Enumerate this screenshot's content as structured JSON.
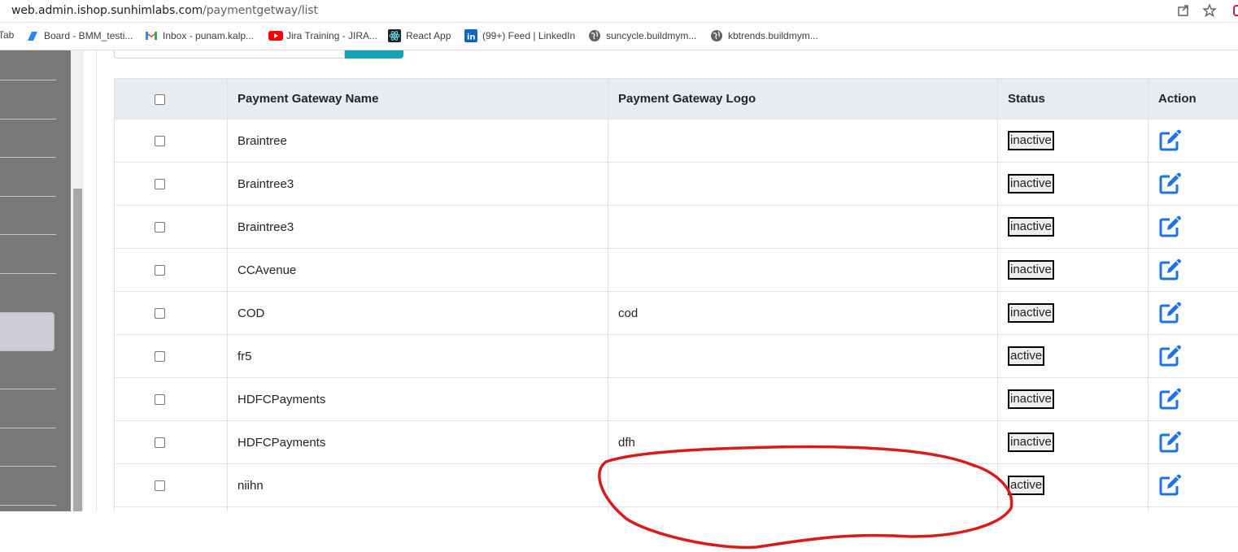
{
  "browser": {
    "url_host": "web.admin.ishop.sunhimlabs.com",
    "url_path": "/paymentgetway/list",
    "bookmarks": [
      {
        "label": "Tab"
      },
      {
        "label": "Board - BMM_testi..."
      },
      {
        "label": "Inbox - punam.kalp..."
      },
      {
        "label": "Jira Training - JIRA..."
      },
      {
        "label": "React App"
      },
      {
        "label": "(99+) Feed | LinkedIn"
      },
      {
        "label": "suncycle.buildmym..."
      },
      {
        "label": "kbtrends.buildmym..."
      }
    ]
  },
  "table": {
    "headers": {
      "name": "Payment Gateway Name",
      "logo": "Payment Gateway Logo",
      "status": "Status",
      "action": "Action"
    },
    "rows": [
      {
        "name": "Braintree",
        "logo": "",
        "status": "inactive"
      },
      {
        "name": "Braintree3",
        "logo": "",
        "status": "inactive"
      },
      {
        "name": "Braintree3",
        "logo": "",
        "status": "inactive"
      },
      {
        "name": "CCAvenue",
        "logo": "",
        "status": "inactive"
      },
      {
        "name": "COD",
        "logo": "cod",
        "status": "inactive"
      },
      {
        "name": "fr5",
        "logo": "",
        "status": "active"
      },
      {
        "name": "HDFCPayments",
        "logo": "",
        "status": "inactive"
      },
      {
        "name": "HDFCPayments",
        "logo": "dfh",
        "status": "inactive"
      },
      {
        "name": "niihn",
        "logo": "",
        "status": "active"
      },
      {
        "name": "",
        "logo": "",
        "status": ""
      }
    ]
  },
  "colors": {
    "edit_icon": "#1a73e8",
    "annotation": "#d81b1b",
    "sidebar": "#7a7777",
    "header_bg": "#e9ecef",
    "search_button": "#17a2b8"
  },
  "icons": {
    "share": "share-icon",
    "star": "star-icon",
    "edit": "edit-icon"
  }
}
